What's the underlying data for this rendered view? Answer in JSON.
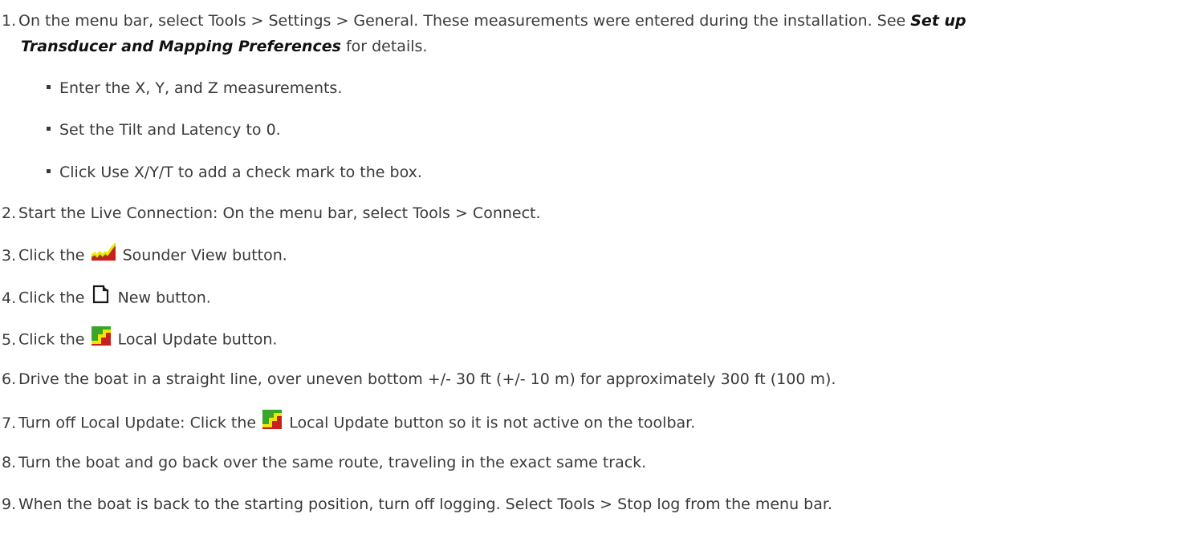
{
  "steps": [
    {
      "num": "1.",
      "text_a": "On the menu bar, select Tools > Settings > General. These measurements were entered during the installation. See ",
      "ref_a": "Set up",
      "ref_b": "Transducer and Mapping Preferences",
      "text_b": " for details.",
      "bullets": [
        "Enter the X, Y, and Z measurements.",
        "Set the Tilt and Latency to 0.",
        "Click Use X/Y/T to add a check mark to the box."
      ]
    },
    {
      "num": "2.",
      "text": "Start the Live Connection: On the menu bar, select Tools > Connect."
    },
    {
      "num": "3.",
      "pre": "Click the",
      "icon": "sounder-view-icon",
      "post": "Sounder View button."
    },
    {
      "num": "4.",
      "pre": "Click the",
      "icon": "new-document-icon",
      "post": "New button."
    },
    {
      "num": "5.",
      "pre": "Click the",
      "icon": "local-update-icon",
      "post": "Local Update button."
    },
    {
      "num": "6.",
      "text": "Drive the boat in a straight line, over uneven bottom +/- 30 ft (+/- 10 m) for approximately 300 ft (100 m)."
    },
    {
      "num": "7.",
      "pre": "Turn off Local Update: Click the",
      "icon": "local-update-icon",
      "post": "Local Update button so it is not active on the toolbar."
    },
    {
      "num": "8.",
      "text": "Turn the boat and go back over the same route, traveling in the exact same track."
    },
    {
      "num": "9.",
      "text": "When the boat is back to the starting position, turn off logging. Select Tools > Stop log from the menu bar."
    }
  ],
  "colors": {
    "text": "#3a3a3a",
    "icon_red": "#c8201c",
    "icon_green": "#3aa52b",
    "icon_yellow": "#f2e600"
  }
}
